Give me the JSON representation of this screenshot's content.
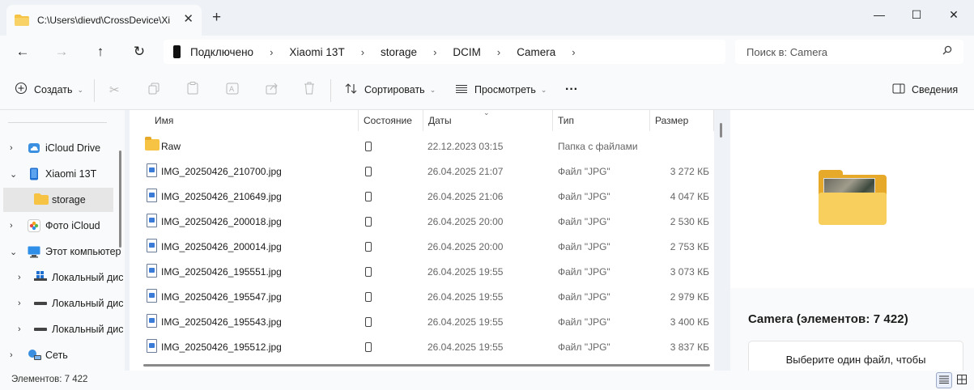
{
  "tab": {
    "title": "C:\\Users\\dievd\\CrossDevice\\Xi",
    "close": "✕",
    "new_tab": "+"
  },
  "window": {
    "minimize": "—",
    "maximize": "☐",
    "close": "✕"
  },
  "nav": {
    "back": "←",
    "forward": "→",
    "up": "↑",
    "refresh": "↻"
  },
  "address": {
    "crumbs": [
      "Подключено",
      "Xiaomi 13T",
      "storage",
      "DCIM",
      "Camera"
    ]
  },
  "search": {
    "placeholder": "Поиск в: Camera"
  },
  "toolbar": {
    "create": "Создать",
    "sort": "Сортировать",
    "view": "Просмотреть",
    "more": "···",
    "details": "Сведения"
  },
  "sidebar": {
    "items": [
      {
        "label": "iCloud Drive",
        "icon": "icloud-icon"
      },
      {
        "label": "Xiaomi 13T",
        "icon": "phone-icon"
      },
      {
        "label": "storage",
        "icon": "folder-icon"
      },
      {
        "label": "Фото iCloud",
        "icon": "photos-icon"
      },
      {
        "label": "Этот компьютер",
        "icon": "computer-icon"
      },
      {
        "label": "Локальный диск",
        "icon": "windows-drive-icon"
      },
      {
        "label": "Локальный диск",
        "icon": "drive-icon"
      },
      {
        "label": "Локальный диск",
        "icon": "drive-icon"
      },
      {
        "label": "Сеть",
        "icon": "network-icon"
      }
    ]
  },
  "columns": {
    "name": "Имя",
    "status": "Состояние",
    "date": "Даты",
    "type": "Тип",
    "size": "Размер"
  },
  "files": [
    {
      "name": "Raw",
      "date": "22.12.2023 03:15",
      "type": "Папка с файлами",
      "size": ""
    },
    {
      "name": "IMG_20250426_210700.jpg",
      "date": "26.04.2025 21:07",
      "type": "Файл \"JPG\"",
      "size": "3 272 КБ"
    },
    {
      "name": "IMG_20250426_210649.jpg",
      "date": "26.04.2025 21:06",
      "type": "Файл \"JPG\"",
      "size": "4 047 КБ"
    },
    {
      "name": "IMG_20250426_200018.jpg",
      "date": "26.04.2025 20:00",
      "type": "Файл \"JPG\"",
      "size": "2 530 КБ"
    },
    {
      "name": "IMG_20250426_200014.jpg",
      "date": "26.04.2025 20:00",
      "type": "Файл \"JPG\"",
      "size": "2 753 КБ"
    },
    {
      "name": "IMG_20250426_195551.jpg",
      "date": "26.04.2025 19:55",
      "type": "Файл \"JPG\"",
      "size": "3 073 КБ"
    },
    {
      "name": "IMG_20250426_195547.jpg",
      "date": "26.04.2025 19:55",
      "type": "Файл \"JPG\"",
      "size": "2 979 КБ"
    },
    {
      "name": "IMG_20250426_195543.jpg",
      "date": "26.04.2025 19:55",
      "type": "Файл \"JPG\"",
      "size": "3 400 КБ"
    },
    {
      "name": "IMG_20250426_195512.jpg",
      "date": "26.04.2025 19:55",
      "type": "Файл \"JPG\"",
      "size": "3 837 КБ"
    }
  ],
  "details": {
    "title": "Camera",
    "count": "(элементов: 7 422)",
    "hint": "Выберите один файл, чтобы"
  },
  "statusbar": {
    "text": "Элементов: 7 422"
  },
  "colors": {
    "folder": "#f6c344",
    "accent": "#3b7bd8",
    "selection": "#e6e6e6"
  }
}
